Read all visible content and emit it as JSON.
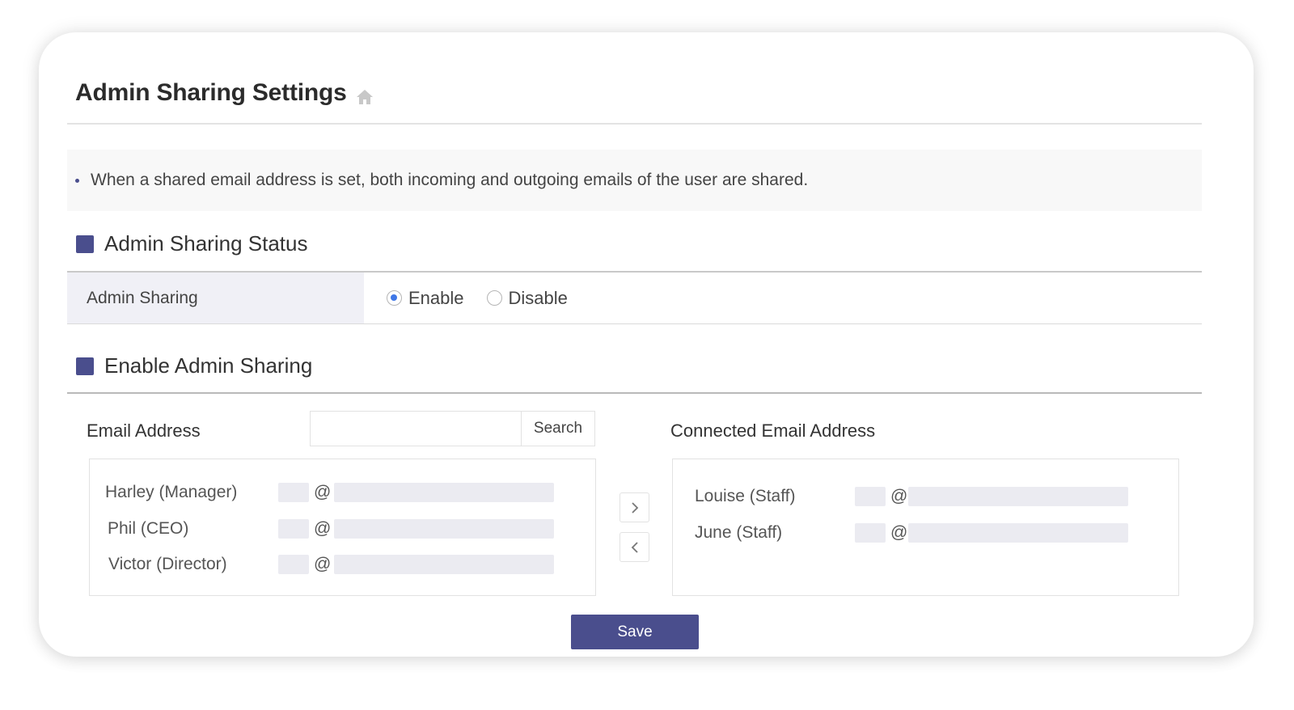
{
  "page": {
    "title": "Admin Sharing Settings",
    "title_icon": "home-icon"
  },
  "notice": {
    "text": "When a shared email address is set, both incoming and outgoing emails of the user are shared."
  },
  "status_section": {
    "heading": "Admin Sharing Status",
    "row_label": "Admin Sharing",
    "options": [
      {
        "label": "Enable",
        "selected": true
      },
      {
        "label": "Disable",
        "selected": false
      }
    ]
  },
  "enable_section": {
    "heading": "Enable Admin Sharing",
    "email_label": "Email Address",
    "search": {
      "value": "",
      "placeholder": "",
      "button_label": "Search"
    },
    "connected_label": "Connected Email Address",
    "available": [
      {
        "name": "Harley (Manager)",
        "at": "@"
      },
      {
        "name": "Phil (CEO)",
        "at": "@"
      },
      {
        "name": "Victor (Director)",
        "at": "@"
      }
    ],
    "connected": [
      {
        "name": "Louise (Staff)",
        "at": "@"
      },
      {
        "name": "June (Staff)",
        "at": "@"
      }
    ],
    "move_right_icon": "chevron-right-icon",
    "move_left_icon": "chevron-left-icon"
  },
  "actions": {
    "save_label": "Save"
  },
  "colors": {
    "accent": "#4a4e8d",
    "radio_selected": "#3f77e6",
    "header_cell_bg": "#f0f0f6",
    "notice_bg": "#f8f8f8"
  }
}
